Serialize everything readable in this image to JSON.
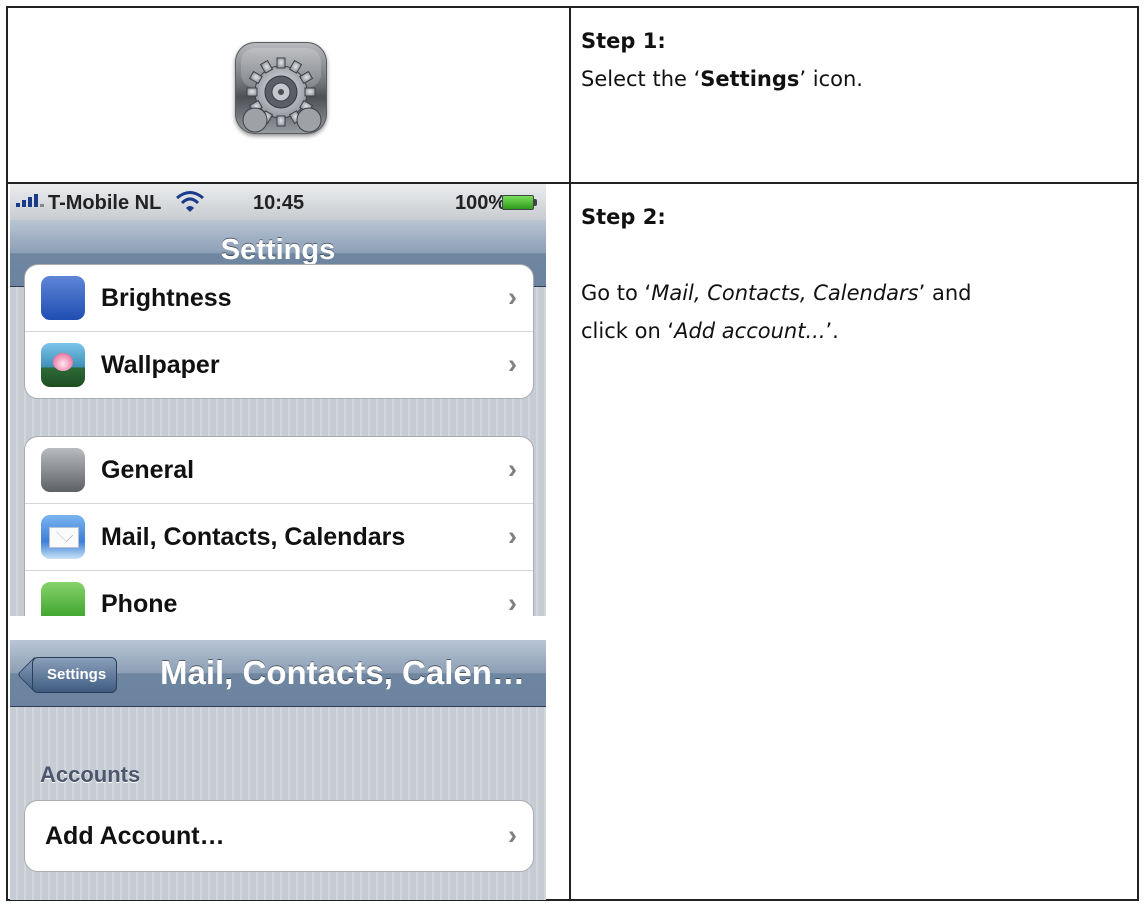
{
  "step1": {
    "heading": "Step 1:",
    "text_before": "Select the ‘",
    "text_bold": "Settings",
    "text_after": "’ icon.",
    "icon_name": "settings-gear-icon"
  },
  "step2": {
    "heading": "Step 2:",
    "line1_before": "Go to ‘",
    "line1_italic": "Mail, Contacts, Calendars",
    "line1_after": "’ and",
    "line2_before": "click on ‘",
    "line2_italic": "Add account...",
    "line2_after": "’."
  },
  "phone1": {
    "statusbar": {
      "carrier": "T-Mobile NL",
      "time": "10:45",
      "battery": "100%"
    },
    "nav_title": "Settings",
    "group1": [
      {
        "label": "Brightness",
        "icon": "brightness-icon"
      },
      {
        "label": "Wallpaper",
        "icon": "wallpaper-icon"
      }
    ],
    "group2": [
      {
        "label": "General",
        "icon": "general-gear-icon"
      },
      {
        "label": "Mail, Contacts, Calendars",
        "icon": "mail-icon"
      },
      {
        "label": "Phone",
        "icon": "phone-icon"
      }
    ],
    "chevron": "›"
  },
  "phone2": {
    "back_label": "Settings",
    "nav_title": "Mail, Contacts, Calen…",
    "section_header": "Accounts",
    "add_account": "Add Account…",
    "chevron": "›"
  }
}
